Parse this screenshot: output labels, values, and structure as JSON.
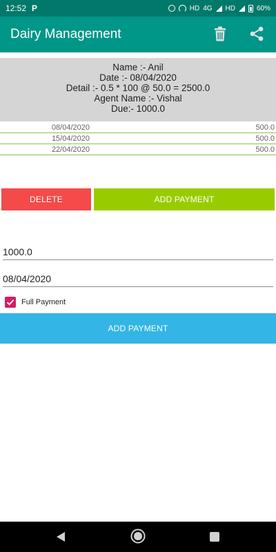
{
  "status_bar": {
    "time": "12:52",
    "app_badge": "P",
    "network_1": "HD",
    "network_type": "4G",
    "network_2": "HD",
    "battery": "60%"
  },
  "app_bar": {
    "title": "Dairy Management",
    "icons": [
      "trash-icon",
      "share-icon"
    ]
  },
  "info": {
    "name_line": "Name :- Anil",
    "date_line": "Date :- 08/04/2020",
    "detail_line": "Detail :- 0.5 * 100 @ 50.0 = 2500.0",
    "agent_line": "Agent Name :- Vishal",
    "due_line": "Due:- 1000.0"
  },
  "payments": [
    {
      "date": "08/04/2020",
      "amount": "500.0"
    },
    {
      "date": "15/04/2020",
      "amount": "500.0"
    },
    {
      "date": "22/04/2020",
      "amount": "500.0"
    }
  ],
  "actions": {
    "delete_label": "DELETE",
    "add_payment_label": "ADD PAYMENT"
  },
  "form": {
    "amount_value": "1000.0",
    "date_value": "08/04/2020",
    "full_payment_label": "Full Payment",
    "full_payment_checked": true,
    "submit_label": "ADD PAYMENT"
  },
  "colors": {
    "status_bar": "#00796b",
    "app_bar": "#009688",
    "delete": "#f44a4a",
    "add_top": "#99cc00",
    "add_bottom": "#33b5e5",
    "checkbox": "#d81b60",
    "row_divider": "#8bc34a"
  },
  "nav_bar": {
    "icons": [
      "back-icon",
      "home-icon",
      "recent-apps-icon"
    ]
  }
}
